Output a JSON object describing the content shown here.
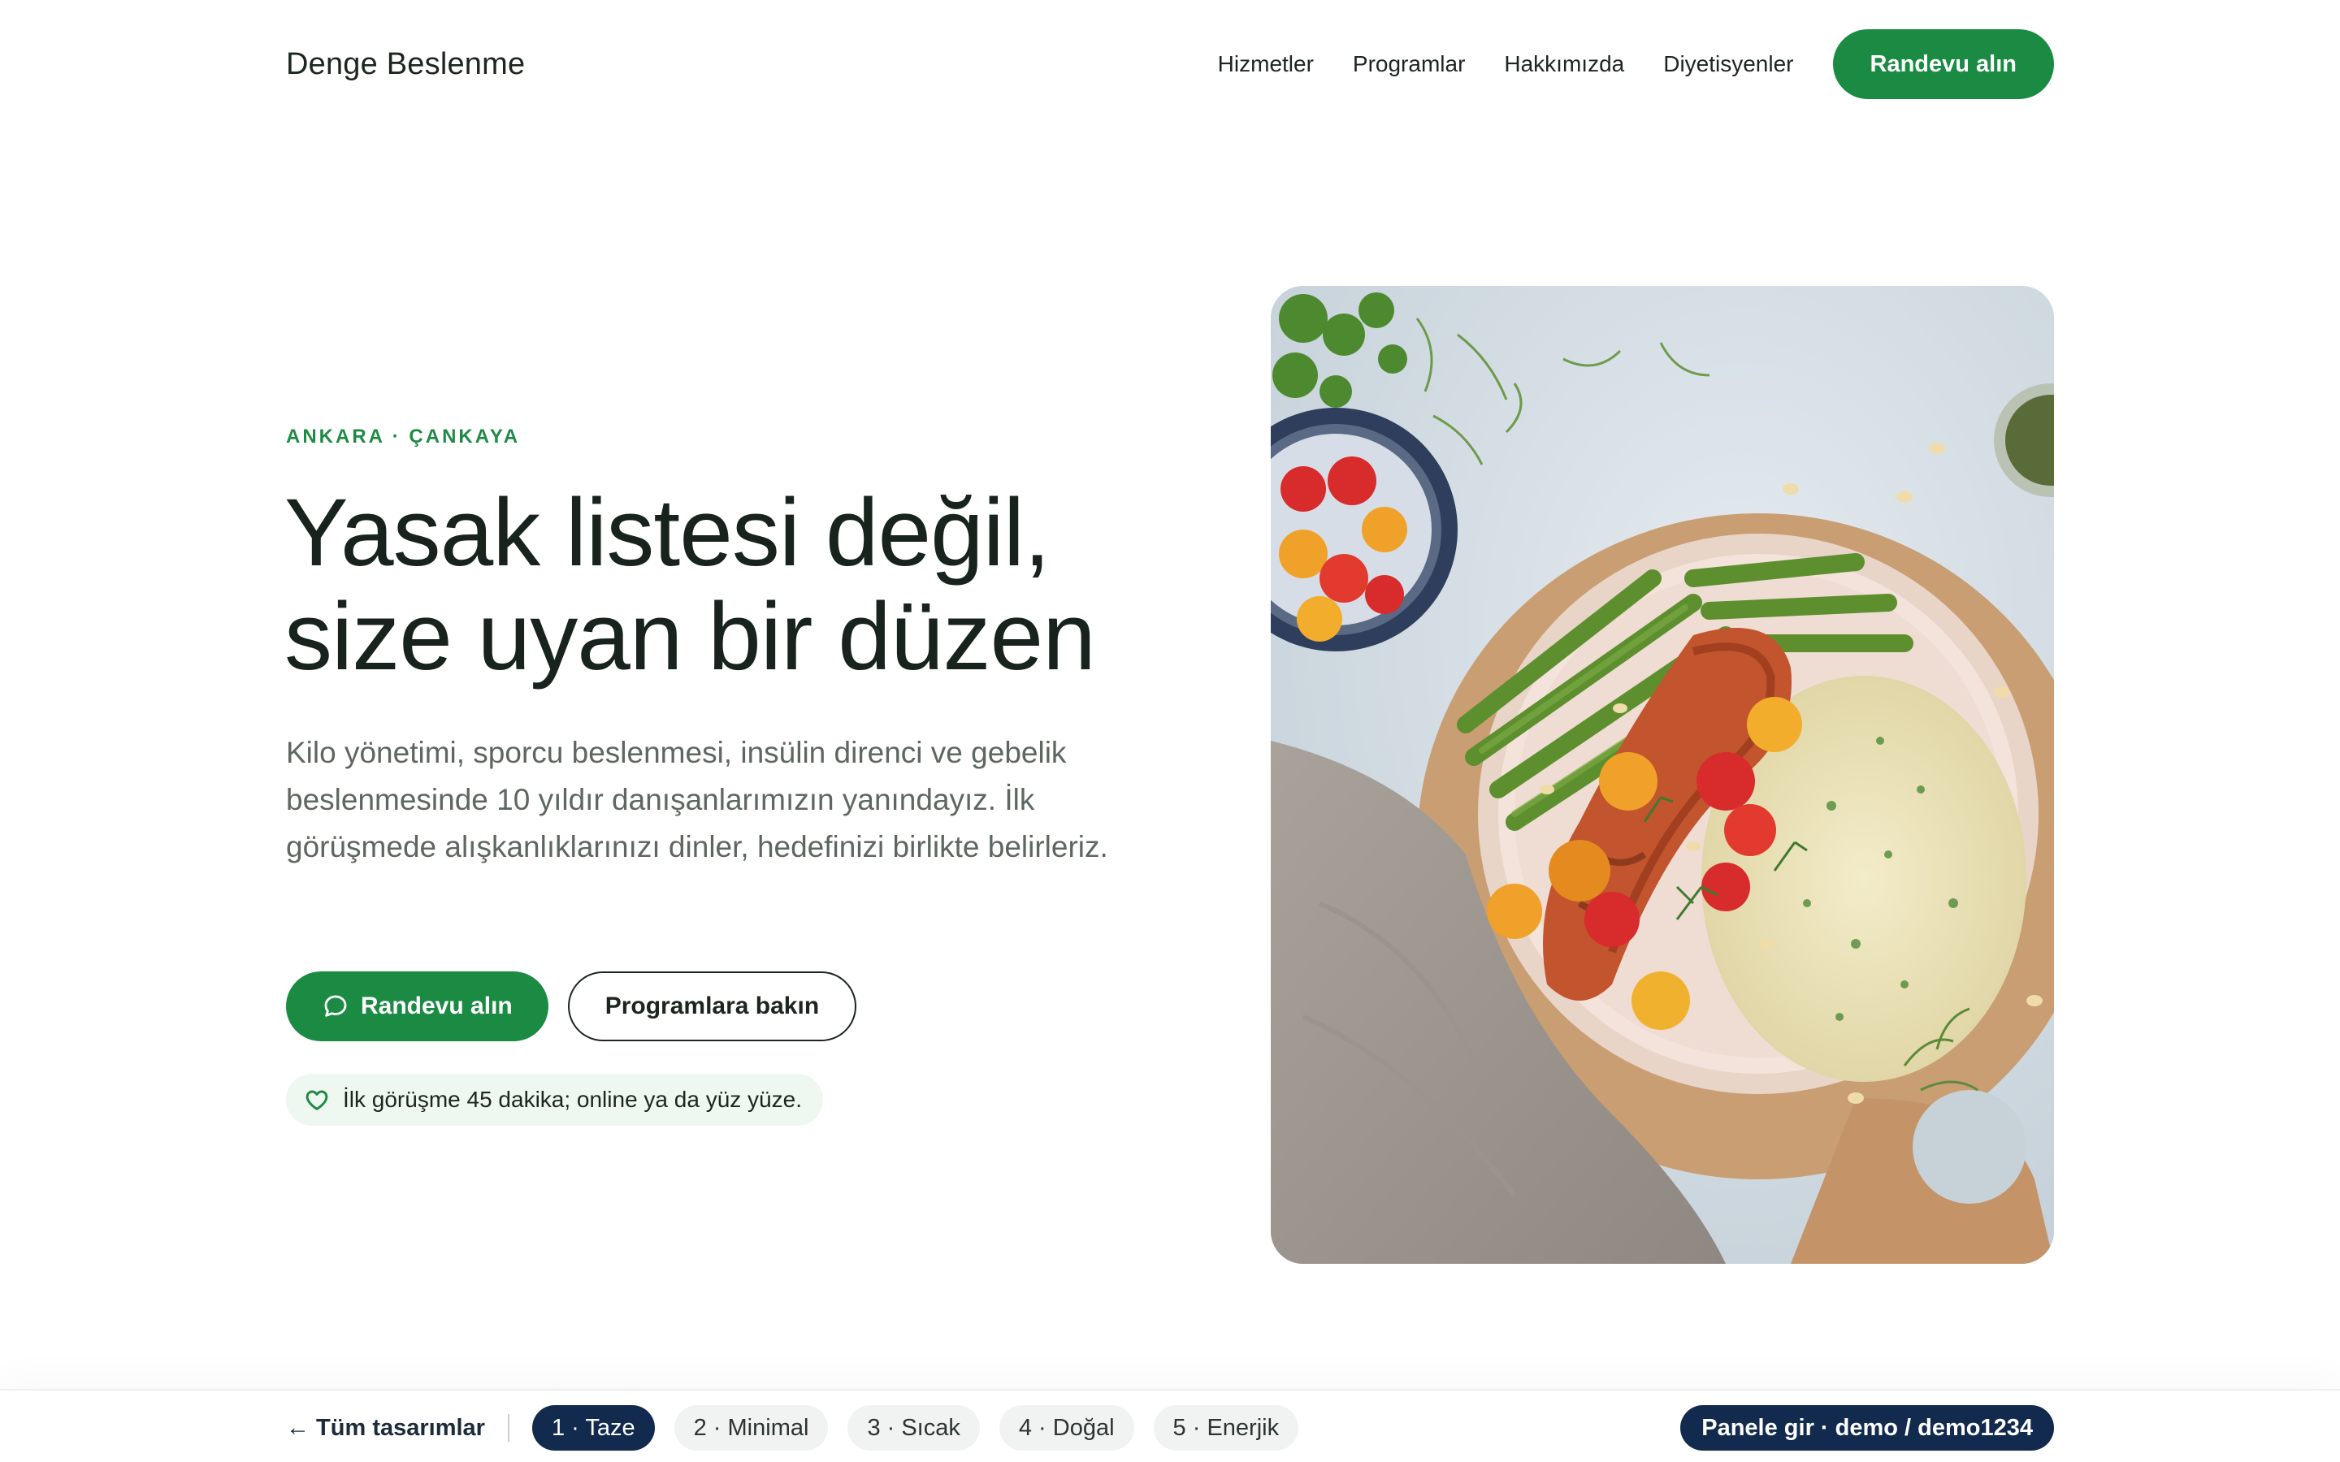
{
  "header": {
    "brand": "Denge Beslenme",
    "nav": [
      "Hizmetler",
      "Programlar",
      "Hakkımızda",
      "Diyetisyenler"
    ],
    "cta_label": "Randevu alın"
  },
  "hero": {
    "eyebrow": "ANKARA · ÇANKAYA",
    "headline_line1": "Yasak listesi değil,",
    "headline_line2": "size uyan bir düzen",
    "lead": "Kilo yönetimi, sporcu beslenmesi, insülin direnci ve gebelik beslenmesinde 10 yıldır danışanlarımızın yanındayız. İlk görüşmede alışkanlıklarınızı dinler, hedefinizi birlikte belirleriz.",
    "primary_cta": "Randevu alın",
    "primary_cta_icon": "chat-bubble-icon",
    "secondary_cta": "Programlara bakın",
    "note": "İlk görüşme 45 dakika; online ya da yüz yüze.",
    "note_icon": "heart-icon",
    "image_subject": "salmon-green-beans-rice-plate"
  },
  "bottom_bar": {
    "back_label": "← Tüm tasarımlar",
    "variants": [
      "1 · Taze",
      "2 · Minimal",
      "3 · Sıcak",
      "4 · Doğal",
      "5 · Enerjik"
    ],
    "active_variant": "1 · Taze",
    "panel_label": "Panele gir · demo / demo1234"
  },
  "colors": {
    "brand_green": "#1b8a43",
    "dark_navy": "#112a4d",
    "text_dark": "#17231c",
    "text_muted": "#5d6760",
    "note_bg": "#eef7f0"
  }
}
